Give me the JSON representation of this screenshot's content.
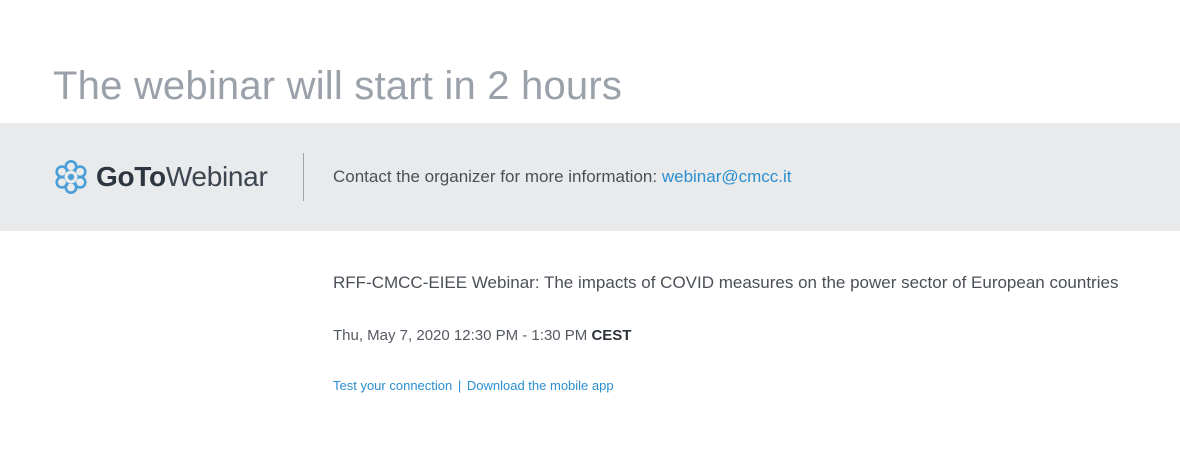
{
  "header": {
    "headline": "The webinar will start in 2 hours"
  },
  "banner": {
    "brand": {
      "name_bold": "GoTo",
      "name_regular": "Webinar",
      "icon": "gotowebinar-flower-logo-icon",
      "color": "#4a9fd9"
    },
    "contact_text": "Contact the organizer for more information:",
    "contact_email": "webinar@cmcc.it",
    "background_color": "#e9eaeb"
  },
  "event": {
    "title": "RFF-CMCC-EIEE Webinar: The impacts of COVID measures on the power sector of European countries",
    "datetime": "Thu, May 7, 2020 12:30 PM - 1:30 PM",
    "timezone": "CEST"
  },
  "links": {
    "test_connection": "Test your connection",
    "separator": "|",
    "download_app": "Download the mobile app",
    "color": "#2b8fd0"
  }
}
